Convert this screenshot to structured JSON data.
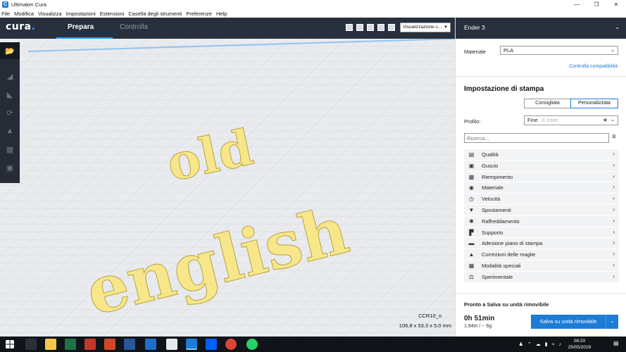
{
  "window": {
    "title": "Ultimaker Cura"
  },
  "menu": [
    "File",
    "Modifica",
    "Visualizza",
    "Impostazioni",
    "Estensioni",
    "Casella degli strumenti",
    "Preferenze",
    "Help"
  ],
  "header": {
    "logo": "cura",
    "logo_dot": ".",
    "tabs": [
      "Prepara",
      "Controlla"
    ],
    "view_select": "Visualizzazione c..."
  },
  "viewport": {
    "model_name": "CCR10_o",
    "dimensions": "106.8 x 53.3 x 5.0 mm"
  },
  "panel": {
    "printer": "Ender 3",
    "material_label": "Materiale",
    "material_value": "PLA",
    "compat_link": "Controlla compatibilità",
    "section_title": "Impostazione di stampa",
    "mode_recommended": "Consigliata",
    "mode_custom": "Personalizzata",
    "profile_label": "Profilo:",
    "profile_value": "Fine",
    "profile_sub": "0.1mm",
    "search_placeholder": "Ricerca...",
    "settings": [
      {
        "label": "Qualità",
        "icon": "quality-icon"
      },
      {
        "label": "Guscio",
        "icon": "shell-icon"
      },
      {
        "label": "Riempimento",
        "icon": "infill-icon"
      },
      {
        "label": "Materiale",
        "icon": "material-icon"
      },
      {
        "label": "Velocità",
        "icon": "speed-icon"
      },
      {
        "label": "Spostamenti",
        "icon": "travel-icon"
      },
      {
        "label": "Raffreddamento",
        "icon": "cooling-icon"
      },
      {
        "label": "Supporto",
        "icon": "support-icon"
      },
      {
        "label": "Adesione piano di stampa",
        "icon": "adhesion-icon"
      },
      {
        "label": "Correzioni delle maglie",
        "icon": "mesh-fix-icon"
      },
      {
        "label": "Modalità speciali",
        "icon": "special-modes-icon"
      },
      {
        "label": "Sperimentale",
        "icon": "experimental-icon"
      }
    ],
    "ready_text": "Pronto a Salva su unità rimovibile",
    "time": "0h 51min",
    "usage": "1.94m / ~ 6g",
    "save_button": "Salva su unità rimovibile"
  },
  "taskbar": {
    "time": "08:20",
    "date": "25/05/2019"
  },
  "colors": {
    "header": "#28303e",
    "accent": "#1c7cd6",
    "model": "#f7e68a"
  }
}
